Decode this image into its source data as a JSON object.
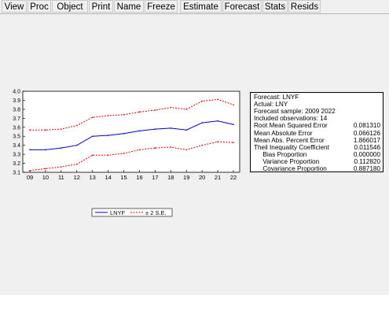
{
  "toolbar": {
    "buttons": [
      "View",
      "Proc",
      "Object",
      "Print",
      "Name",
      "Freeze",
      "Estimate",
      "Forecast",
      "Stats",
      "Resids"
    ]
  },
  "chart_data": {
    "type": "line",
    "x": [
      "09",
      "10",
      "11",
      "12",
      "13",
      "14",
      "15",
      "16",
      "17",
      "18",
      "19",
      "20",
      "21",
      "22"
    ],
    "series": [
      {
        "name": "LNYF",
        "color": "#0000cc",
        "style": "solid",
        "values": [
          3.35,
          3.35,
          3.37,
          3.4,
          3.5,
          3.51,
          3.53,
          3.56,
          3.58,
          3.59,
          3.57,
          3.65,
          3.67,
          3.63
        ]
      },
      {
        "name": "± 2 S.E.",
        "color": "#e00000",
        "style": "dashed",
        "values": [
          3.57,
          3.57,
          3.58,
          3.62,
          3.71,
          3.73,
          3.74,
          3.77,
          3.79,
          3.82,
          3.8,
          3.89,
          3.91,
          3.85
        ]
      },
      {
        "name": "",
        "color": "#e00000",
        "style": "dashed",
        "values": [
          3.12,
          3.14,
          3.16,
          3.19,
          3.29,
          3.29,
          3.31,
          3.35,
          3.37,
          3.38,
          3.35,
          3.4,
          3.44,
          3.43
        ]
      }
    ],
    "yticks": [
      "4.0",
      "3.9",
      "3.8",
      "3.7",
      "3.6",
      "3.5",
      "3.4",
      "3.3",
      "3.2",
      "3.1"
    ],
    "ylim": [
      3.1,
      4.0
    ],
    "grid": false,
    "legend": [
      "LNYF",
      "± 2 S.E."
    ],
    "legend_position": "bottom"
  },
  "stats": {
    "lines": [
      {
        "label": "Forecast: LNYF",
        "value": ""
      },
      {
        "label": "Actual: LNY",
        "value": ""
      },
      {
        "label": "Forecast sample: 2009 2022",
        "value": ""
      },
      {
        "label": "Included observations: 14",
        "value": ""
      },
      {
        "label": "Root Mean Squared Error",
        "value": "0.081310"
      },
      {
        "label": "Mean Absolute Error",
        "value": "0.066126"
      },
      {
        "label": "Mean Abs. Percent Error",
        "value": "1.866017"
      },
      {
        "label": "Theil Inequality Coefficient",
        "value": "0.011546"
      },
      {
        "label": "     Bias Proportion",
        "value": "0.000000"
      },
      {
        "label": "     Variance Proportion",
        "value": "0.112820"
      },
      {
        "label": "     Covariance Proportion",
        "value": "0.887180"
      }
    ]
  }
}
